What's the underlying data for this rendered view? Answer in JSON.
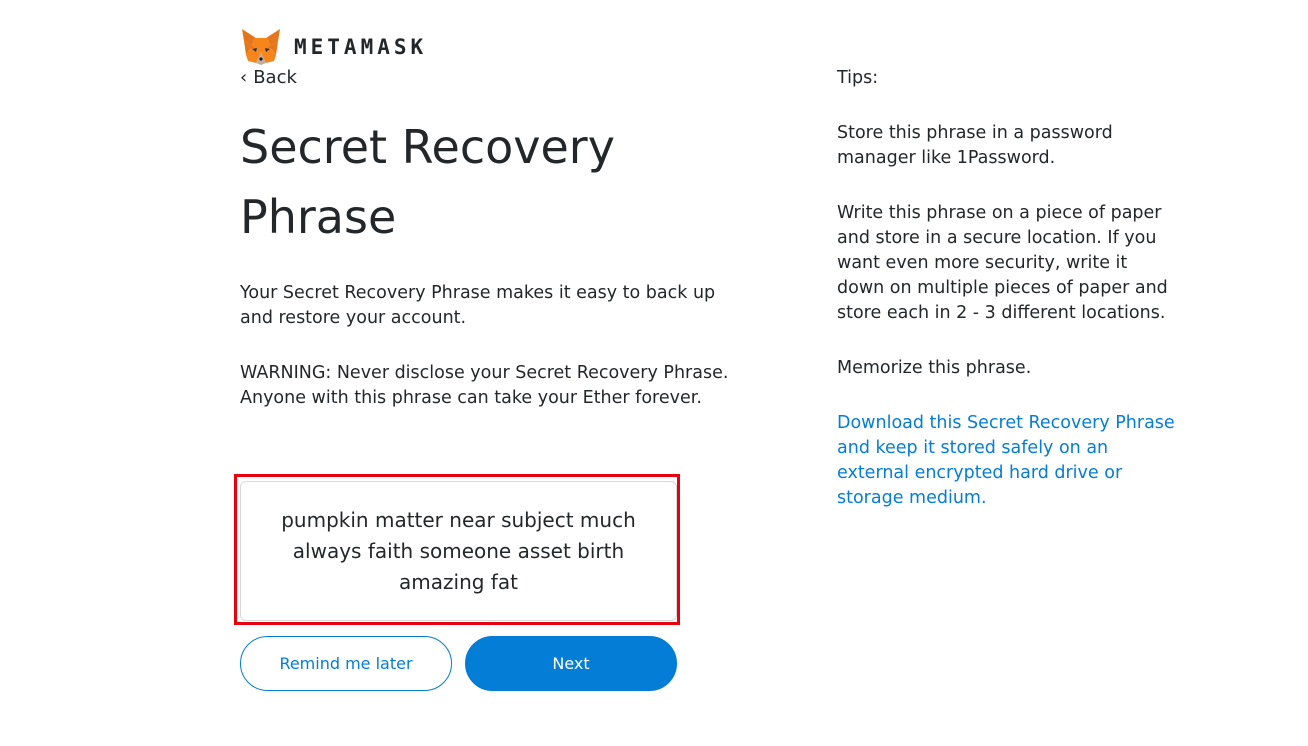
{
  "brand": {
    "wordmark": "METAMASK",
    "logo_icon": "fox-icon"
  },
  "nav": {
    "back_label": "Back",
    "back_icon": "chevron-left-icon"
  },
  "main": {
    "title": "Secret Recovery Phrase",
    "intro": "Your Secret Recovery Phrase makes it easy to back up and restore your account.",
    "warning": "WARNING: Never disclose your Secret Recovery Phrase. Anyone with this phrase can take your Ether forever.",
    "phrase": "pumpkin matter near subject much always faith someone asset birth amazing fat"
  },
  "buttons": {
    "remind_label": "Remind me later",
    "next_label": "Next"
  },
  "tips": {
    "title": "Tips:",
    "items": [
      "Store this phrase in a password manager like 1Password.",
      "Write this phrase on a piece of paper and store in a secure location. If you want even more security, write it down on multiple pieces of paper and store each in 2 - 3 different locations.",
      "Memorize this phrase."
    ],
    "download_link": "Download this Secret Recovery Phrase and keep it stored safely on an external encrypted hard drive or storage medium."
  },
  "colors": {
    "accent": "#037dd6",
    "text": "#24272a",
    "highlight_border": "#e8000e"
  }
}
